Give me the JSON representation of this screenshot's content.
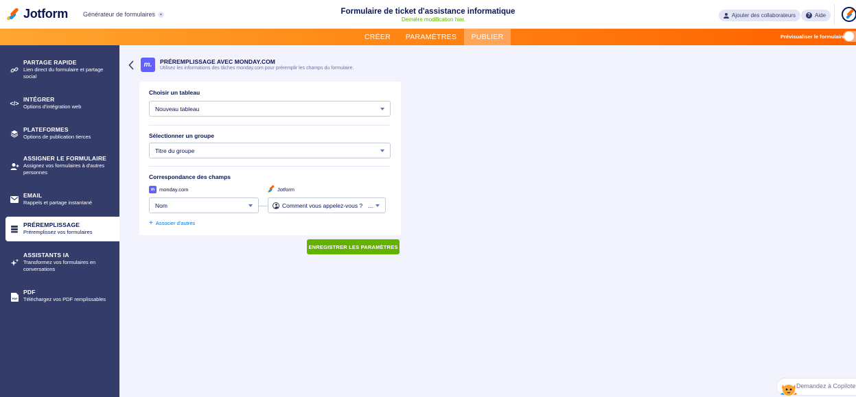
{
  "brand": {
    "name": "Jotform"
  },
  "topbar": {
    "builder_label": "Générateur de formulaires",
    "form_title": "Formulaire de ticket d'assistance informatique",
    "last_modified": "Dernière modification hier.",
    "add_collaborators": "Ajouter des collaborateurs",
    "help": "Aide"
  },
  "nav": {
    "tabs": [
      "CRÉER",
      "PARAMÈTRES",
      "PUBLIER"
    ],
    "active_tab": "PUBLIER",
    "preview_label": "Prévisualiser le formulaire"
  },
  "sidebar": {
    "items": [
      {
        "title": "PARTAGE RAPIDE",
        "desc": "Lien direct du formulaire et partage social",
        "icon": "link-icon"
      },
      {
        "title": "INTÉGRER",
        "desc": "Options d'intégration web",
        "icon": "code-icon"
      },
      {
        "title": "PLATEFORMES",
        "desc": "Options de publication tierces",
        "icon": "layers-icon"
      },
      {
        "title": "ASSIGNER LE FORMULAIRE",
        "desc": "Assignez vos formulaires à d'autres personnes",
        "icon": "user-add-icon"
      },
      {
        "title": "EMAIL",
        "desc": "Rappels et partage instantané",
        "icon": "envelope-icon"
      },
      {
        "title": "PRÉREMPLISSAGE",
        "desc": "Préremplissez vos formulaires",
        "icon": "database-icon"
      },
      {
        "title": "ASSISTANTS IA",
        "desc": "Transformez vos formulaires en conversations",
        "icon": "sparkle-icon"
      },
      {
        "title": "PDF",
        "desc": "Téléchargez vos PDF remplissables",
        "icon": "pdf-icon"
      }
    ],
    "active_index": 5
  },
  "panel": {
    "title": "PRÉREMPLISSAGE AVEC MONDAY.COM",
    "subtitle": "Utilisez les informations des tâches monday.com pour préremplir les champs du formulaire.",
    "board_label": "Choisir un tableau",
    "board_value": "Nouveau tableau",
    "group_label": "Sélectionner un groupe",
    "group_value": "Titre du groupe",
    "mapping_label": "Correspondance des champs",
    "source_left": "monday.com",
    "source_right": "Jotform",
    "left_field_value": "Nom",
    "right_field_value": "Comment vous appelez-vous ?",
    "right_field_more": "...",
    "associate_label": "Associer d'autres",
    "save_label": "ENREGISTRER LES PARAMÈTRES"
  },
  "copilot": {
    "label": "Demandez à Copilote"
  },
  "colors": {
    "navy": "#0a1551",
    "sidebar": "#343c6a",
    "orange": "#ff6100",
    "green": "#64b200",
    "monday": "#6161ff",
    "link": "#0075e3"
  }
}
